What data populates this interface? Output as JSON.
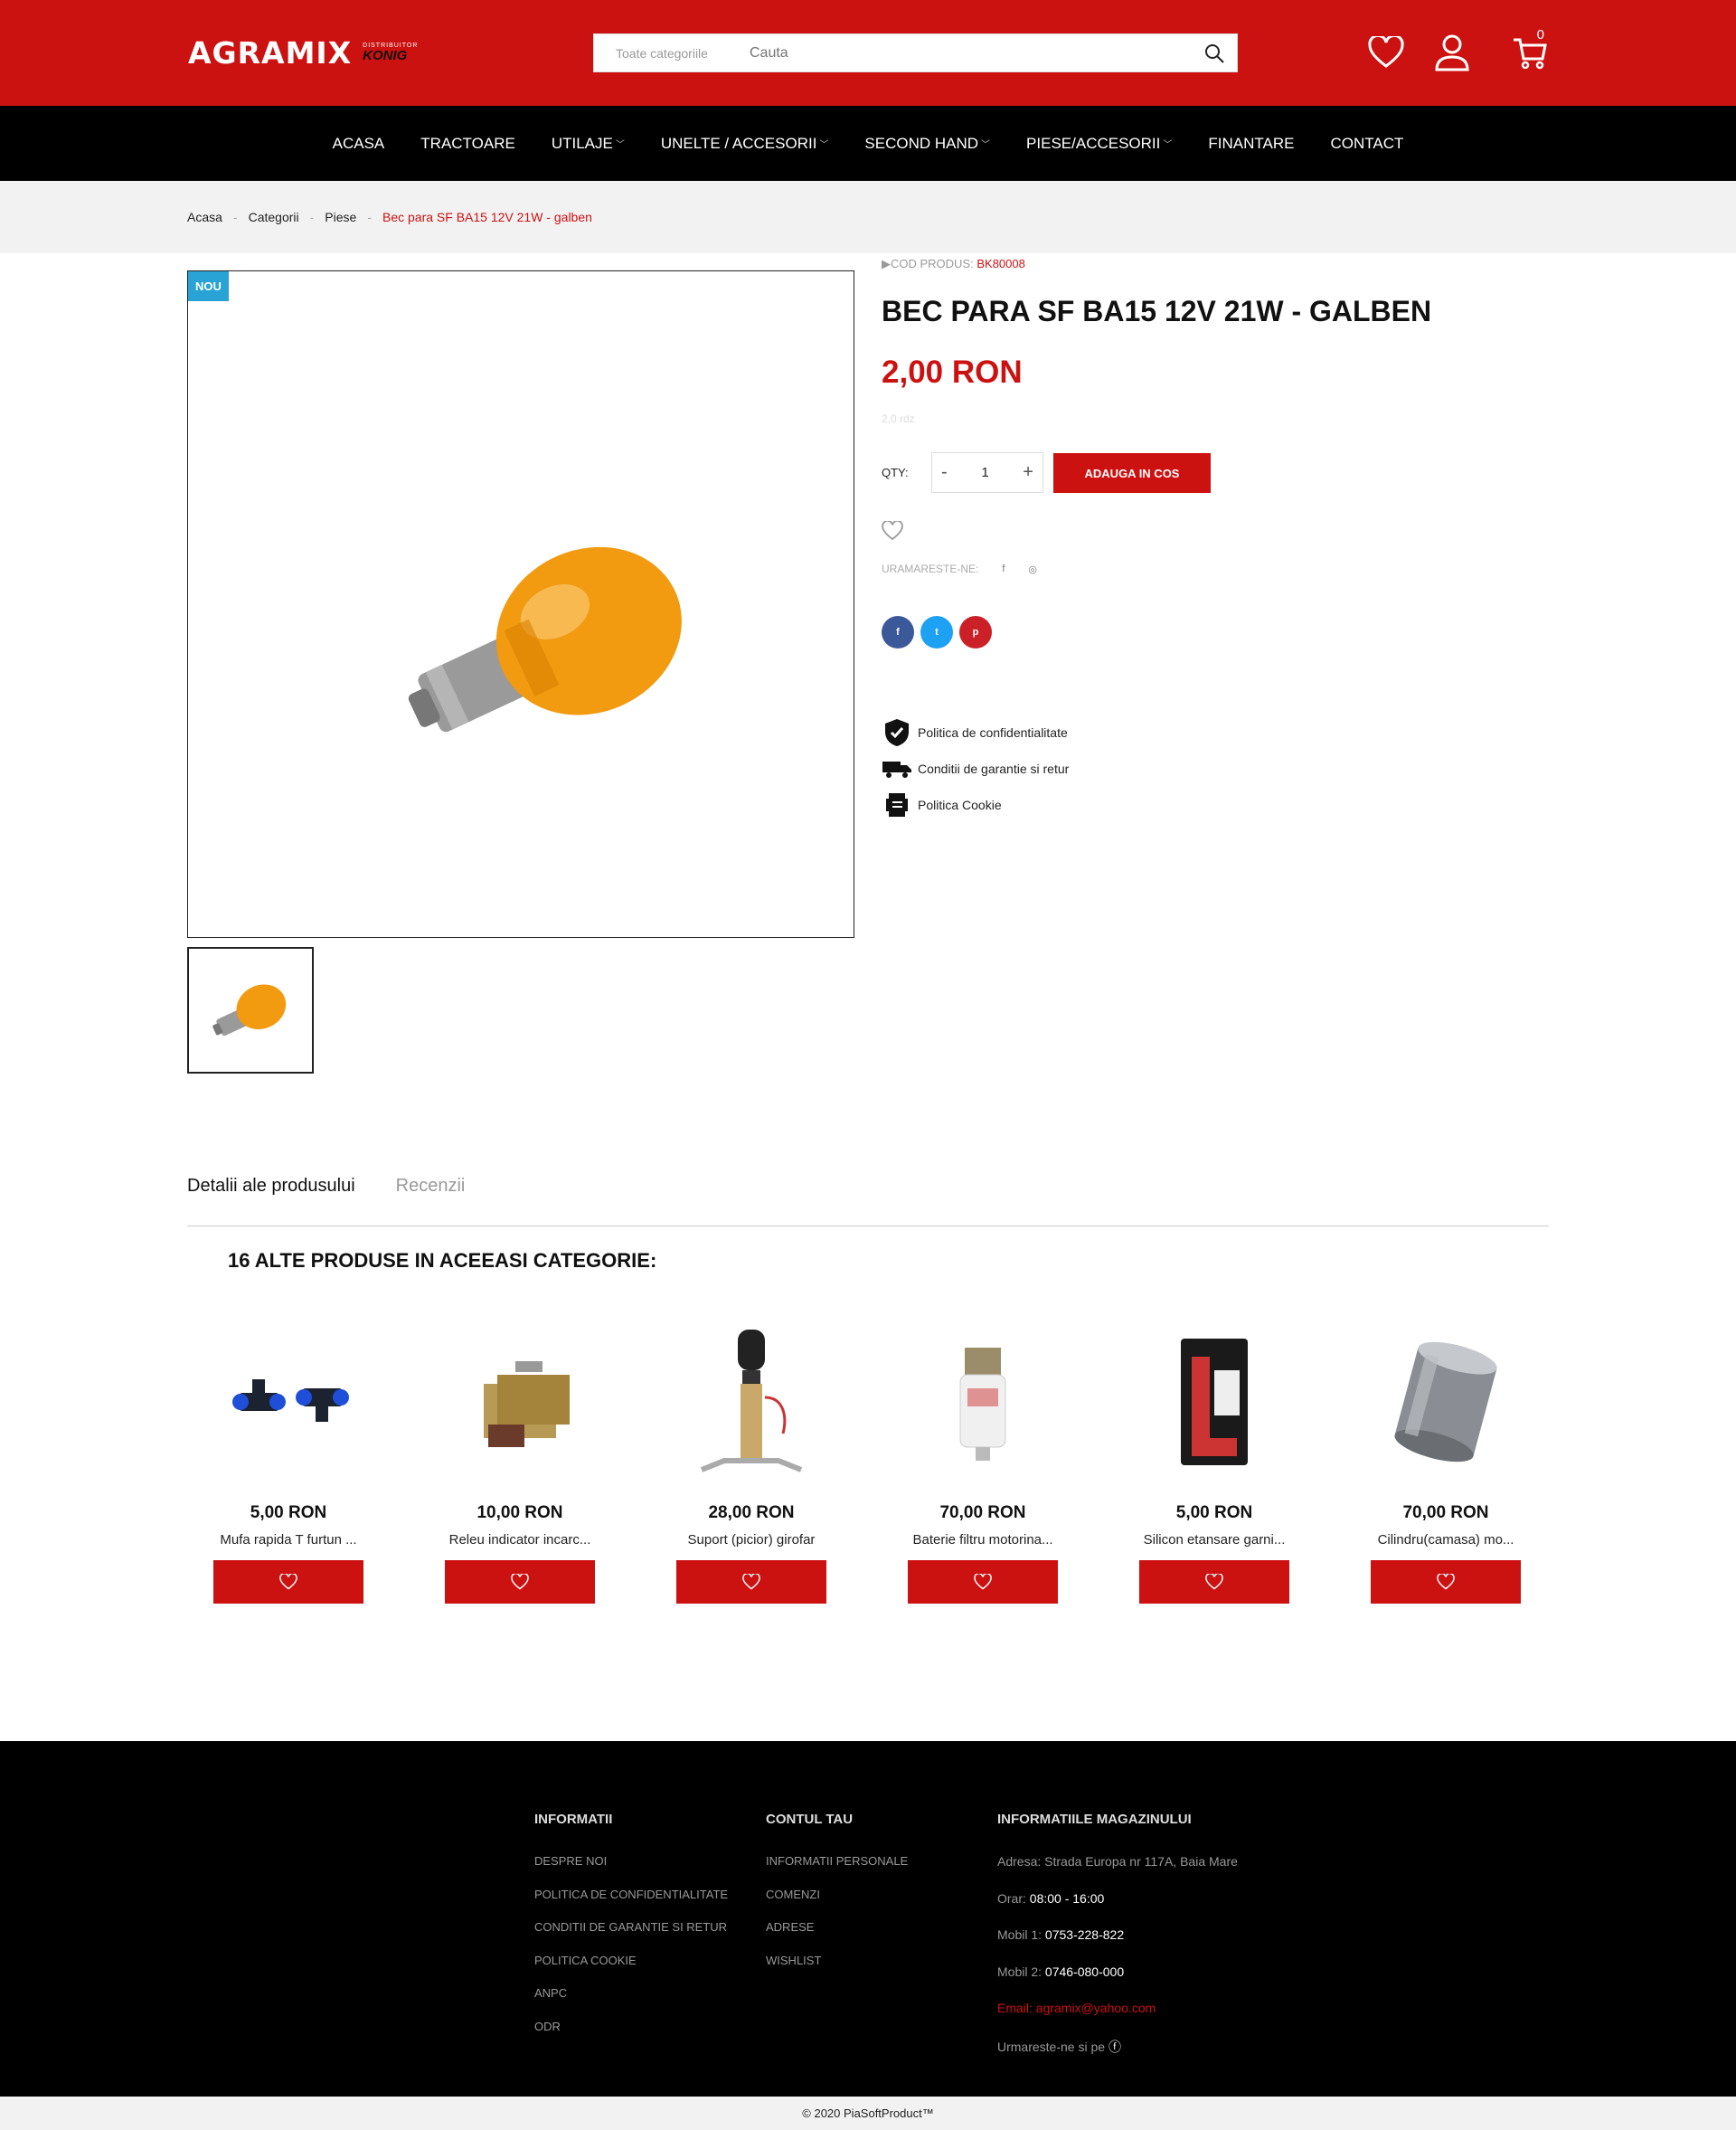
{
  "header": {
    "logo_main": "AGRAMIX",
    "logo_dist": "DISTRIBUITOR",
    "logo_brand": "KONIG",
    "search_category": "Toate categoriile",
    "search_placeholder": "Cauta",
    "cart_count": "0"
  },
  "nav": {
    "items": [
      {
        "label": "ACASA",
        "caret": false
      },
      {
        "label": "TRACTOARE",
        "caret": false
      },
      {
        "label": "UTILAJE",
        "caret": true
      },
      {
        "label": "UNELTE / ACCESORII",
        "caret": true
      },
      {
        "label": "SECOND HAND",
        "caret": true
      },
      {
        "label": "PIESE/ACCESORII",
        "caret": true
      },
      {
        "label": "FINANTARE",
        "caret": false
      },
      {
        "label": "CONTACT",
        "caret": false
      }
    ]
  },
  "breadcrumb": [
    "Acasa",
    "Categorii",
    "Piese",
    "Bec para SF BA15 12V 21W - galben"
  ],
  "product": {
    "badge": "NOU",
    "sku_label": "COD PRODUS:",
    "sku": "BK80008",
    "title": "BEC PARA SF BA15 12V 21W - GALBEN",
    "price": "2,00 RON",
    "tax_note": "2,0 rdz",
    "qty_label": "QTY:",
    "qty_value": "1",
    "qty_minus": "-",
    "qty_plus": "+",
    "add_to_cart": "ADAUGA IN COS",
    "follow_label": "URAMARESTE-NE:",
    "policies": [
      "Politica de confidentialitate",
      "Conditii de garantie si retur",
      "Politica Cookie"
    ]
  },
  "tabs": [
    "Detalii ale produsului",
    "Recenzii"
  ],
  "related": {
    "title": "16 ALTE PRODUSE IN ACEEASI CATEGORIE:",
    "products": [
      {
        "price": "5,00 RON",
        "name": "Mufa rapida T furtun ..."
      },
      {
        "price": "10,00 RON",
        "name": "Releu indicator incarc..."
      },
      {
        "price": "28,00 RON",
        "name": "Suport (picior) girofar"
      },
      {
        "price": "70,00 RON",
        "name": "Baterie filtru motorina..."
      },
      {
        "price": "5,00 RON",
        "name": "Silicon etansare garni..."
      },
      {
        "price": "70,00 RON",
        "name": "Cilindru(camasa) mo..."
      }
    ]
  },
  "footer": {
    "col1": {
      "title": "INFORMATII",
      "links": [
        "DESPRE NOI",
        "POLITICA DE CONFIDENTIALITATE",
        "CONDITII DE GARANTIE SI RETUR",
        "POLITICA COOKIE",
        "ANPC",
        "ODR"
      ]
    },
    "col2": {
      "title": "CONTUL TAU",
      "links": [
        "INFORMATII PERSONALE",
        "COMENZI",
        "ADRESE",
        "WISHLIST"
      ]
    },
    "col3": {
      "title": "INFORMATIILE MAGAZINULUI",
      "address": "Adresa: Strada Europa nr 117A, Baia Mare",
      "hours_label": "Orar: ",
      "hours": "08:00 - 16:00",
      "mobile1_label": "Mobil 1: ",
      "mobile1": "0753-228-822",
      "mobile2_label": "Mobil 2: ",
      "mobile2": "0746-080-000",
      "email": "Email: agramix@yahoo.com",
      "follow": "Urmareste-ne si pe"
    },
    "copyright": "© 2020 PiaSoftProduct™"
  },
  "colors": {
    "brand_red": "#cc1111",
    "nav_black": "#000000",
    "badge_blue": "#29a3d6",
    "facebook": "#3b5998",
    "twitter": "#1da1f2",
    "pinterest": "#cb2027"
  }
}
